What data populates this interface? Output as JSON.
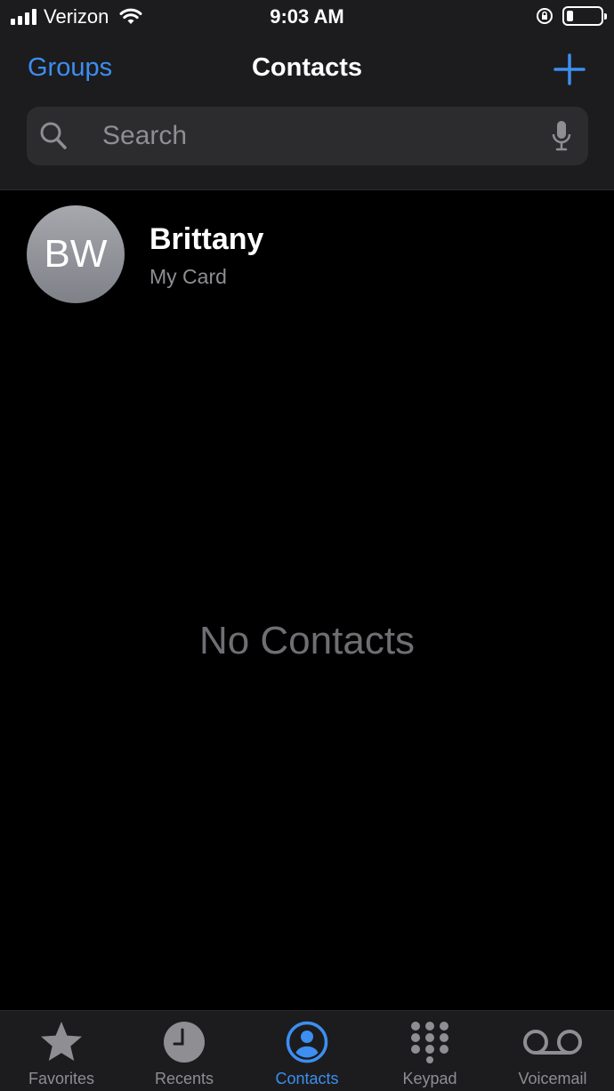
{
  "status_bar": {
    "carrier": "Verizon",
    "time": "9:03 AM",
    "battery_level": 0.2,
    "icons": [
      "signal-icon",
      "wifi-icon",
      "orientation-lock-icon",
      "battery-icon"
    ]
  },
  "header": {
    "groups_label": "Groups",
    "title": "Contacts",
    "add_icon": "plus-icon"
  },
  "search": {
    "placeholder": "Search"
  },
  "my_card": {
    "initials": "BW",
    "name": "Brittany",
    "subtitle": "My Card"
  },
  "empty_state": "No Contacts",
  "tabs": [
    {
      "label": "Favorites",
      "icon": "star-icon"
    },
    {
      "label": "Recents",
      "icon": "clock-icon"
    },
    {
      "label": "Contacts",
      "icon": "person-circle-icon",
      "active": true
    },
    {
      "label": "Keypad",
      "icon": "keypad-icon"
    },
    {
      "label": "Voicemail",
      "icon": "voicemail-icon"
    }
  ],
  "colors": {
    "accent": "#3d8ef0",
    "background": "#000000",
    "bar": "#1c1c1e",
    "inactive": "#8e8e93"
  }
}
